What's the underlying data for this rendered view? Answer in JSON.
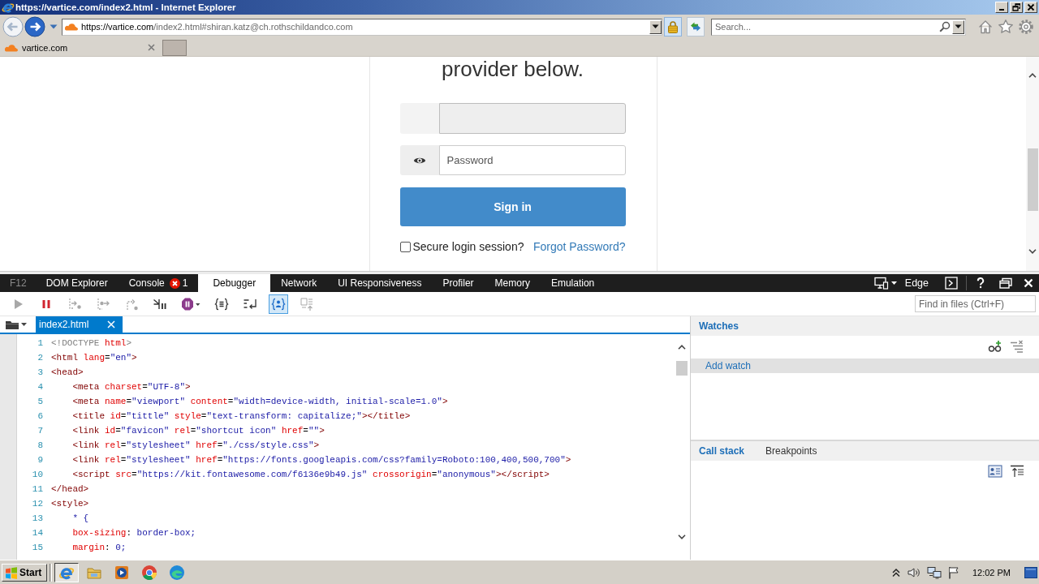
{
  "window": {
    "title": "https://vartice.com/index2.html - Internet Explorer"
  },
  "nav_buttons": [
    {
      "kind": "back",
      "disabled": true
    },
    {
      "kind": "forward",
      "disabled": false
    }
  ],
  "address_bar": {
    "host": "https://vartice.com",
    "path": "/index2.html#shiran.katz@ch.rothschildandco.com"
  },
  "search": {
    "placeholder": "Search..."
  },
  "browser_tabs": [
    {
      "label": "vartice.com"
    }
  ],
  "page": {
    "heading": "provider below.",
    "fields": [
      {
        "kind": "text",
        "disabled": true
      },
      {
        "kind": "password",
        "placeholder": "Password",
        "disabled": false
      }
    ],
    "submit": "Sign in",
    "remember": {
      "label": "Secure login session?",
      "checked": false
    },
    "link": "Forgot Password?"
  },
  "devtools": {
    "label": "F12",
    "tabs": [
      {
        "label": "DOM Explorer",
        "selected": false
      },
      {
        "label": "Console",
        "selected": false,
        "errors": "1"
      },
      {
        "label": "Debugger",
        "selected": true
      },
      {
        "label": "Network",
        "selected": false
      },
      {
        "label": "UI Responsiveness",
        "selected": false
      },
      {
        "label": "Profiler",
        "selected": false
      },
      {
        "label": "Memory",
        "selected": false
      },
      {
        "label": "Emulation",
        "selected": false
      }
    ],
    "mode": "Edge",
    "tools": [
      {
        "kind": "continue",
        "disabled": true,
        "on": false
      },
      {
        "kind": "break",
        "disabled": false,
        "on": false
      },
      {
        "kind": "step_into",
        "disabled": true,
        "on": false
      },
      {
        "kind": "step_over",
        "disabled": true,
        "on": false
      },
      {
        "kind": "step_out",
        "disabled": true,
        "on": false
      },
      {
        "kind": "worker",
        "disabled": false,
        "on": false
      },
      {
        "kind": "exceptions",
        "disabled": false,
        "on": false
      },
      {
        "kind": "pretty",
        "disabled": false,
        "on": false
      },
      {
        "kind": "wrap",
        "disabled": false,
        "on": false
      },
      {
        "kind": "jmc",
        "disabled": false,
        "on": true
      },
      {
        "kind": "list",
        "disabled": true,
        "on": false
      }
    ],
    "find": {
      "placeholder": "Find in files (Ctrl+F)"
    },
    "files": [
      {
        "label": "index2.html",
        "selected": true
      }
    ],
    "code": [
      {
        "number": "1",
        "tokens": [
          {
            "kind": "doctype",
            "text": "<!DOCTYPE"
          },
          {
            "kind": "attr",
            "text": " html"
          },
          {
            "kind": "doctype",
            "text": ">"
          }
        ]
      },
      {
        "number": "2",
        "tokens": [
          {
            "kind": "tag",
            "text": "<html"
          },
          {
            "kind": "attr",
            "text": " lang"
          },
          {
            "kind": "plain",
            "text": "="
          },
          {
            "kind": "value",
            "text": "\"en\""
          },
          {
            "kind": "tag",
            "text": ">"
          }
        ]
      },
      {
        "number": "3",
        "tokens": [
          {
            "kind": "tag",
            "text": "<head>"
          }
        ],
        "children": [
          {
            "number": "4",
            "tokens": [
              {
                "kind": "tag",
                "text": "<meta"
              },
              {
                "kind": "attr",
                "text": " charset"
              },
              {
                "kind": "plain",
                "text": "="
              },
              {
                "kind": "value",
                "text": "\"UTF-8\""
              },
              {
                "kind": "tag",
                "text": ">"
              }
            ]
          },
          {
            "number": "5",
            "tokens": [
              {
                "kind": "tag",
                "text": "<meta"
              },
              {
                "kind": "attr",
                "text": " name"
              },
              {
                "kind": "plain",
                "text": "="
              },
              {
                "kind": "value",
                "text": "\"viewport\""
              },
              {
                "kind": "attr",
                "text": " content"
              },
              {
                "kind": "plain",
                "text": "="
              },
              {
                "kind": "value",
                "text": "\"width=device-width, initial-scale=1.0\""
              },
              {
                "kind": "tag",
                "text": ">"
              }
            ]
          },
          {
            "number": "6",
            "tokens": [
              {
                "kind": "tag",
                "text": "<title"
              },
              {
                "kind": "attr",
                "text": " id"
              },
              {
                "kind": "plain",
                "text": "="
              },
              {
                "kind": "value",
                "text": "\"tittle\""
              },
              {
                "kind": "attr",
                "text": " style"
              },
              {
                "kind": "plain",
                "text": "="
              },
              {
                "kind": "value",
                "text": "\"text-transform: capitalize;\""
              },
              {
                "kind": "tag",
                "text": "></title>"
              }
            ]
          },
          {
            "number": "7",
            "tokens": [
              {
                "kind": "tag",
                "text": "<link"
              },
              {
                "kind": "attr",
                "text": " id"
              },
              {
                "kind": "plain",
                "text": "="
              },
              {
                "kind": "value",
                "text": "\"favicon\""
              },
              {
                "kind": "attr",
                "text": " rel"
              },
              {
                "kind": "plain",
                "text": "="
              },
              {
                "kind": "value",
                "text": "\"shortcut icon\""
              },
              {
                "kind": "attr",
                "text": " href"
              },
              {
                "kind": "plain",
                "text": "="
              },
              {
                "kind": "value",
                "text": "\"\""
              },
              {
                "kind": "tag",
                "text": ">"
              }
            ]
          },
          {
            "number": "8",
            "tokens": [
              {
                "kind": "tag",
                "text": "<link"
              },
              {
                "kind": "attr",
                "text": " rel"
              },
              {
                "kind": "plain",
                "text": "="
              },
              {
                "kind": "value",
                "text": "\"stylesheet\""
              },
              {
                "kind": "attr",
                "text": " href"
              },
              {
                "kind": "plain",
                "text": "="
              },
              {
                "kind": "value",
                "text": "\"./css/style.css\""
              },
              {
                "kind": "tag",
                "text": ">"
              }
            ]
          },
          {
            "number": "9",
            "tokens": [
              {
                "kind": "tag",
                "text": "<link"
              },
              {
                "kind": "attr",
                "text": " rel"
              },
              {
                "kind": "plain",
                "text": "="
              },
              {
                "kind": "value",
                "text": "\"stylesheet\""
              },
              {
                "kind": "attr",
                "text": " href"
              },
              {
                "kind": "plain",
                "text": "="
              },
              {
                "kind": "value",
                "text": "\"https://fonts.googleapis.com/css?family=Roboto:100,400,500,700\""
              },
              {
                "kind": "tag",
                "text": ">"
              }
            ]
          },
          {
            "number": "10",
            "tokens": [
              {
                "kind": "tag",
                "text": "<script"
              },
              {
                "kind": "attr",
                "text": " src"
              },
              {
                "kind": "plain",
                "text": "="
              },
              {
                "kind": "value",
                "text": "\"https://kit.fontawesome.com/f6136e9b49.js\""
              },
              {
                "kind": "attr",
                "text": " crossorigin"
              },
              {
                "kind": "plain",
                "text": "="
              },
              {
                "kind": "value",
                "text": "\"anonymous\""
              },
              {
                "kind": "tag",
                "text": "></script>"
              }
            ]
          }
        ]
      },
      {
        "number": "11",
        "tokens": [
          {
            "kind": "tag",
            "text": "</head>"
          }
        ]
      },
      {
        "number": "12",
        "tokens": [
          {
            "kind": "tag",
            "text": "<style>"
          }
        ],
        "children": [
          {
            "number": "13",
            "tokens": [
              {
                "kind": "value",
                "text": "* {"
              }
            ]
          },
          {
            "number": "14",
            "tokens": [
              {
                "kind": "attr",
                "text": "box-sizing"
              },
              {
                "kind": "plain",
                "text": ": "
              },
              {
                "kind": "value",
                "text": "border-box;"
              }
            ]
          },
          {
            "number": "15",
            "tokens": [
              {
                "kind": "attr",
                "text": "margin"
              },
              {
                "kind": "plain",
                "text": ": "
              },
              {
                "kind": "value",
                "text": "0;"
              }
            ]
          }
        ]
      }
    ],
    "watches": {
      "title": "Watches",
      "add": "Add watch"
    },
    "lower_tabs": [
      {
        "label": "Call stack",
        "selected": true
      },
      {
        "label": "Breakpoints",
        "selected": false
      }
    ]
  },
  "taskbar": {
    "start": "Start",
    "apps": [
      {
        "kind": "ie",
        "selected": true
      },
      {
        "kind": "folder",
        "selected": false
      },
      {
        "kind": "media",
        "selected": false
      },
      {
        "kind": "chrome",
        "selected": false
      },
      {
        "kind": "edge",
        "selected": false
      }
    ],
    "clock": "12:02 PM"
  }
}
